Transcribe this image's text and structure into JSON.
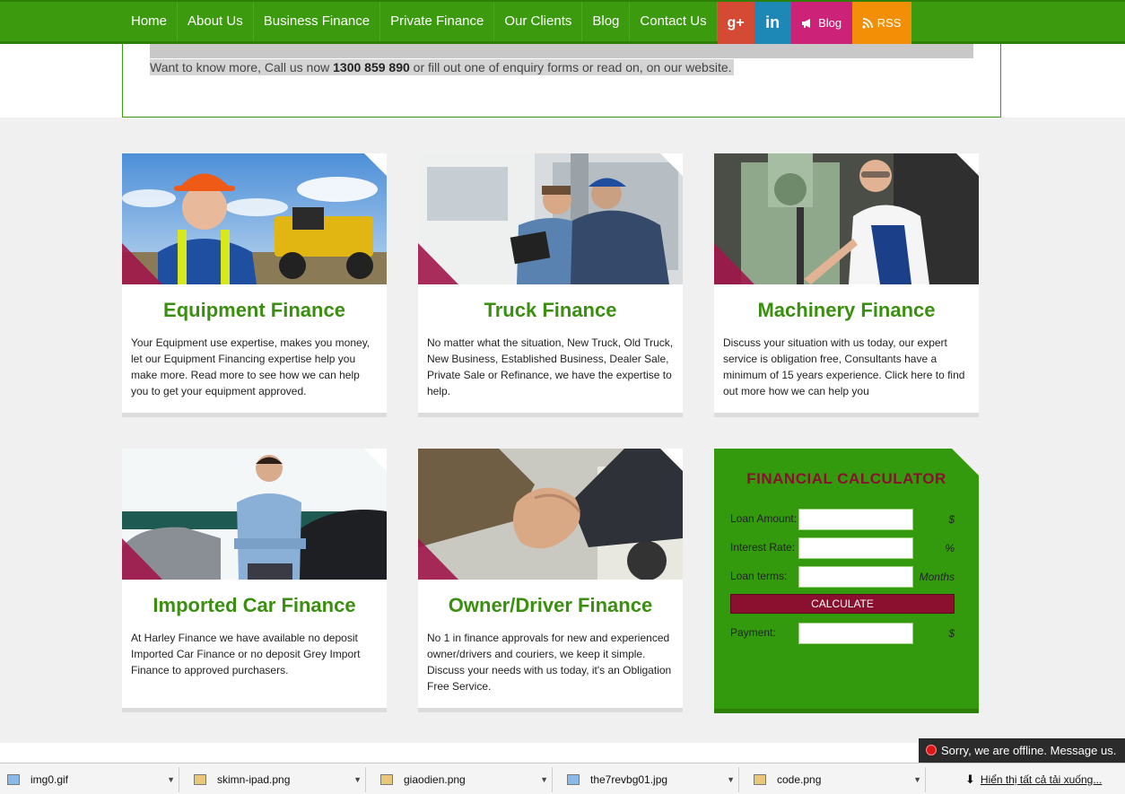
{
  "nav": {
    "items": [
      "Home",
      "About Us",
      "Business Finance",
      "Private Finance",
      "Our Clients",
      "Blog",
      "Contact Us"
    ],
    "social": {
      "gplus_label": "g+",
      "linkedin_label": "in",
      "blog_label": "Blog",
      "rss_label": "RSS"
    }
  },
  "intro": {
    "text_before": "Want to know more, Call us now ",
    "phone": "1300 859 890",
    "text_after": " or fill out one of enquiry forms or read on, on our website."
  },
  "cards": [
    {
      "title": "Equipment Finance",
      "text": "Your Equipment use expertise, makes you money, let our Equipment Financing expertise help you make more. Read more to see how we can help you to get your equipment approved."
    },
    {
      "title": "Truck Finance",
      "text": "No matter what the situation, New Truck, Old Truck, New Business, Established Business, Dealer Sale, Private Sale or Refinance, we have the expertise to help."
    },
    {
      "title": "Machinery Finance",
      "text": "Discuss your situation with us today, our expert service is obligation free, Consultants have a minimum of 15 years experience. Click here to find out more how we can help you"
    },
    {
      "title": "Imported Car Finance",
      "text": "At Harley Finance we have available no deposit Imported Car Finance or no deposit Grey Import Finance to approved purchasers."
    },
    {
      "title": "Owner/Driver Finance",
      "text": "No 1 in finance approvals for new and experienced owner/drivers and couriers, we keep it simple. Discuss your needs with us today, it's an Obligation Free Service."
    }
  ],
  "calculator": {
    "title": "FINANCIAL CALCULATOR",
    "loan_amount_label": "Loan Amount:",
    "loan_amount_unit": "$",
    "interest_rate_label": "Interest Rate:",
    "interest_rate_unit": "%",
    "loan_terms_label": "Loan terms:",
    "loan_terms_unit": "Months",
    "button_label": "CALCULATE",
    "payment_label": "Payment:",
    "payment_unit": "$"
  },
  "chat": {
    "text": "Sorry, we are offline. Message us."
  },
  "downloads": {
    "items": [
      "img0.gif",
      "skimn-ipad.png",
      "giaodien.png",
      "the7revbg01.jpg",
      "code.png"
    ],
    "show_all": "Hiển thị tất cả tải xuống..."
  },
  "colors": {
    "brand_green": "#3b9a0e",
    "title_green": "#3b8f10",
    "calc_accent": "#8b1030"
  }
}
